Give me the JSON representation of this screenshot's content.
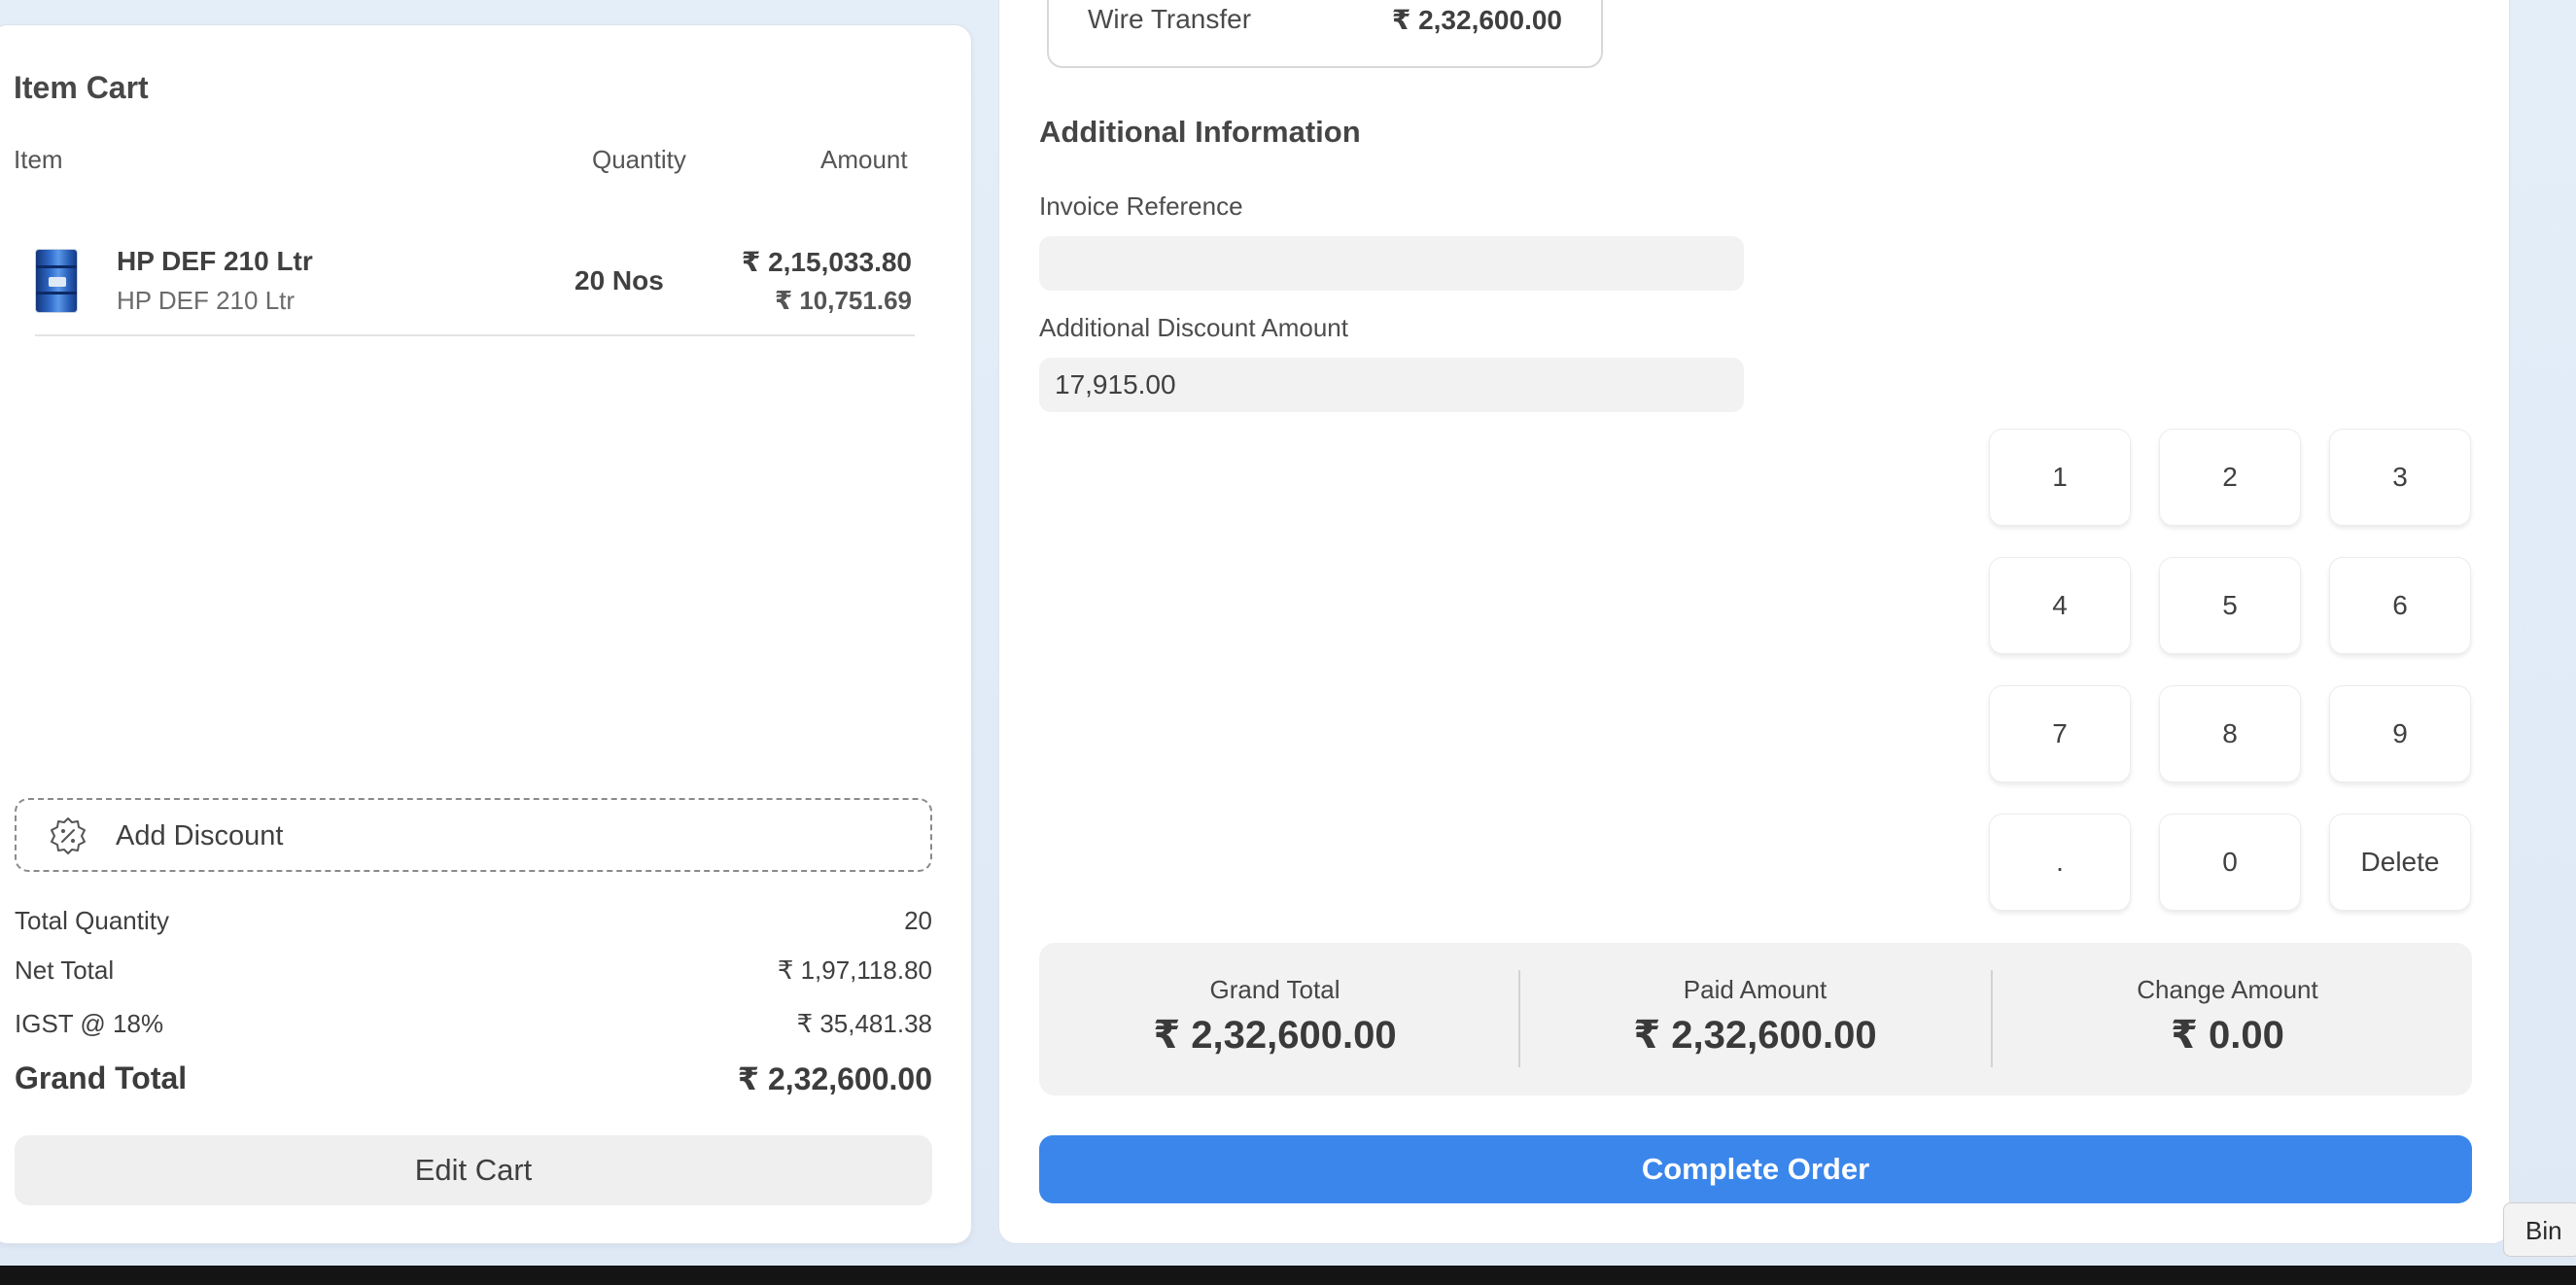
{
  "cart": {
    "title": "Item Cart",
    "columns": {
      "item": "Item",
      "quantity": "Quantity",
      "amount": "Amount"
    },
    "items": [
      {
        "name": "HP DEF 210 Ltr",
        "subtitle": "HP DEF 210 Ltr",
        "quantity": "20 Nos",
        "amount": "₹ 2,15,033.80",
        "rate": "₹ 10,751.69"
      }
    ],
    "add_discount_label": "Add Discount",
    "summary": {
      "total_quantity_label": "Total Quantity",
      "total_quantity": "20",
      "net_total_label": "Net Total",
      "net_total": "₹ 1,97,118.80",
      "tax_label": "IGST @ 18%",
      "tax": "₹ 35,481.38",
      "grand_total_label": "Grand Total",
      "grand_total": "₹ 2,32,600.00"
    },
    "edit_cart_label": "Edit Cart"
  },
  "payment": {
    "method_name": "Wire Transfer",
    "method_amount": "₹ 2,32,600.00",
    "additional_info_title": "Additional Information",
    "invoice_reference_label": "Invoice Reference",
    "invoice_reference_value": "",
    "additional_discount_label": "Additional Discount Amount",
    "additional_discount_value": "17,915.00",
    "keypad": [
      "1",
      "2",
      "3",
      "4",
      "5",
      "6",
      "7",
      "8",
      "9",
      ".",
      "0",
      "Delete"
    ],
    "totals": {
      "grand_total_label": "Grand Total",
      "grand_total": "₹ 2,32,600.00",
      "paid_amount_label": "Paid Amount",
      "paid_amount": "₹ 2,32,600.00",
      "change_amount_label": "Change Amount",
      "change_amount": "₹ 0.00"
    },
    "complete_order_label": "Complete Order"
  },
  "tooltip": {
    "text": "Bin"
  },
  "colors": {
    "primary": "#3b86eb",
    "panel_bg": "#ffffff",
    "field_bg": "#f2f2f2",
    "desktop_bg": "#e4eef9"
  },
  "icons": {
    "discount": "discount-badge-icon"
  }
}
